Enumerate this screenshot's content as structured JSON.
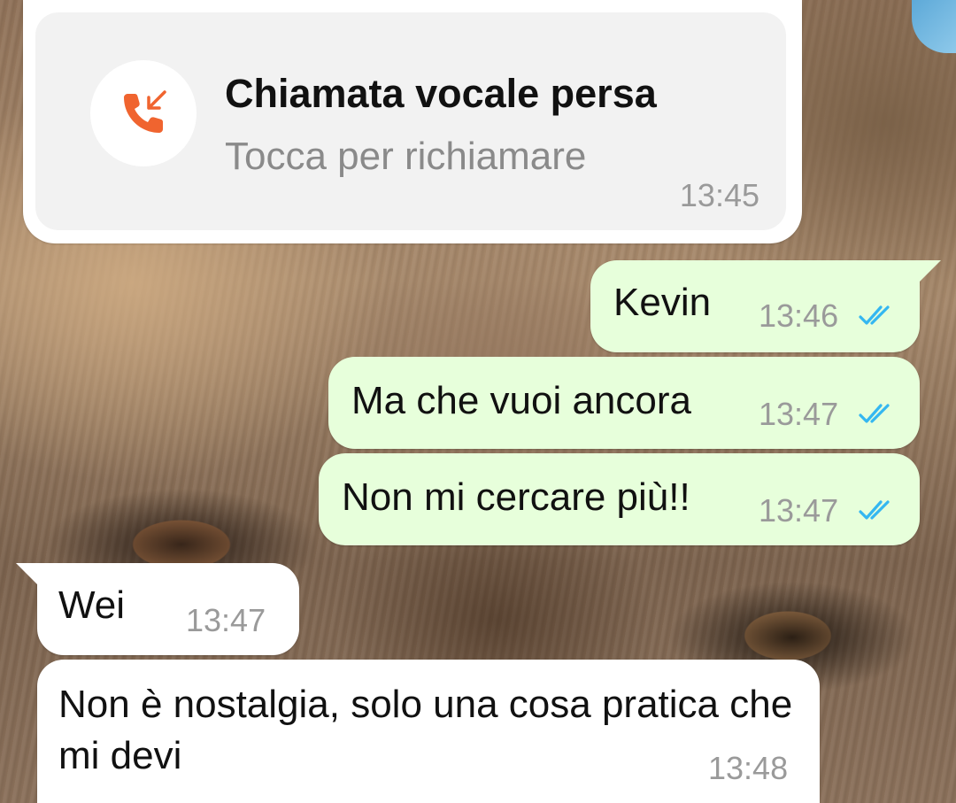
{
  "missed_call": {
    "title": "Chiamata vocale persa",
    "subtitle": "Tocca per richiamare",
    "time": "13:45",
    "icon": "missed-call-icon",
    "icon_color": "#f0642f"
  },
  "messages": [
    {
      "direction": "outgoing",
      "text": "Kevin",
      "time": "13:46",
      "status": "read"
    },
    {
      "direction": "outgoing",
      "text": "Ma che vuoi ancora",
      "time": "13:47",
      "status": "read"
    },
    {
      "direction": "outgoing",
      "text": "Non mi cercare più!!",
      "time": "13:47",
      "status": "read"
    },
    {
      "direction": "incoming",
      "text": "Wei",
      "time": "13:47"
    },
    {
      "direction": "incoming",
      "text": "Non è nostalgia, solo una cosa pratica che mi devi",
      "time": "13:48"
    }
  ],
  "colors": {
    "outgoing_bubble": "#e7ffdb",
    "incoming_bubble": "#ffffff",
    "read_ticks": "#34b7f1"
  }
}
